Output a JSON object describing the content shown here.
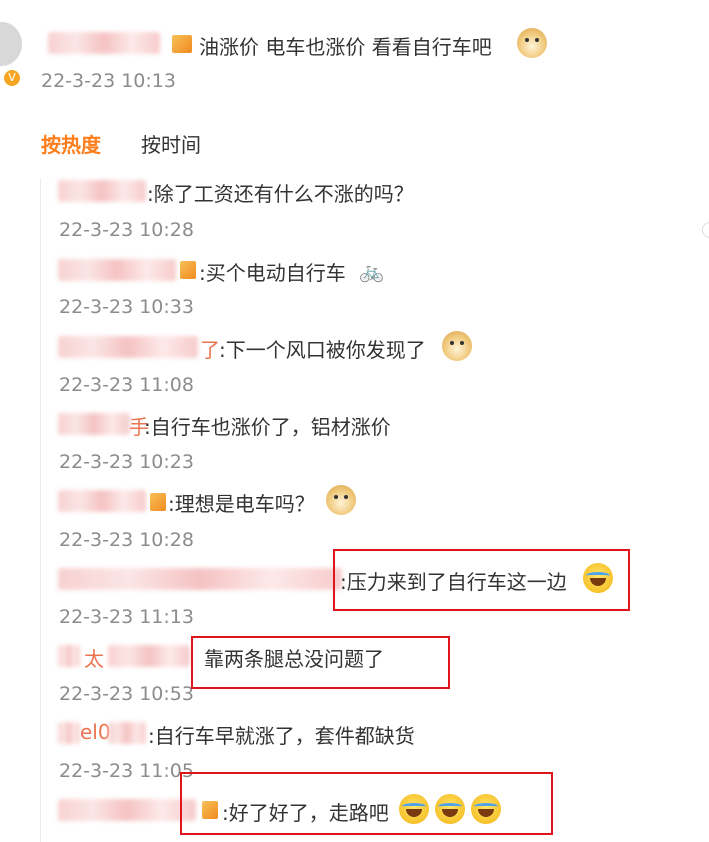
{
  "post": {
    "text": "油涨价 电车也涨价 看看自行车吧",
    "timestamp": "22-3-23 10:13"
  },
  "sort_tabs": {
    "hot": "按热度",
    "time": "按时间"
  },
  "replies": [
    {
      "name_visible": "",
      "text": ":除了工资还有什么不涨的吗？",
      "time": "22-3-23 10:28"
    },
    {
      "name_visible": "",
      "text": ":买个电动自行车",
      "time": "22-3-23 10:33",
      "icon": "bicycle-icon"
    },
    {
      "name_visible": "了",
      "text": ":下一个风口被你发现了",
      "time": "22-3-23 11:08",
      "icon": "doge-emoji"
    },
    {
      "name_visible": "手",
      "text": ":自行车也涨价了，铝材涨价",
      "time": "22-3-23 10:23"
    },
    {
      "name_visible": "",
      "text": ":理想是电车吗？",
      "time": "22-3-23 10:28",
      "icon": "doge-emoji"
    },
    {
      "name_visible": "",
      "text": ":压力来到了自行车这一边",
      "time": "22-3-23 11:13",
      "icon": "laugh-cry-emoji"
    },
    {
      "name_visible": "太",
      "text": "靠两条腿总没问题了",
      "time": "22-3-23 10:53"
    },
    {
      "name_visible": "el0",
      "text": ":自行车早就涨了，套件都缺货",
      "time": "22-3-23 11:05"
    },
    {
      "name_visible": "",
      "text": ":好了好了，走路吧",
      "time": "",
      "icon": "laugh-cry-emoji"
    }
  ],
  "colors": {
    "accent": "#ff7d1a",
    "highlight_box": "#e0151b",
    "timestamp": "#8c8c8c",
    "text": "#333333"
  }
}
